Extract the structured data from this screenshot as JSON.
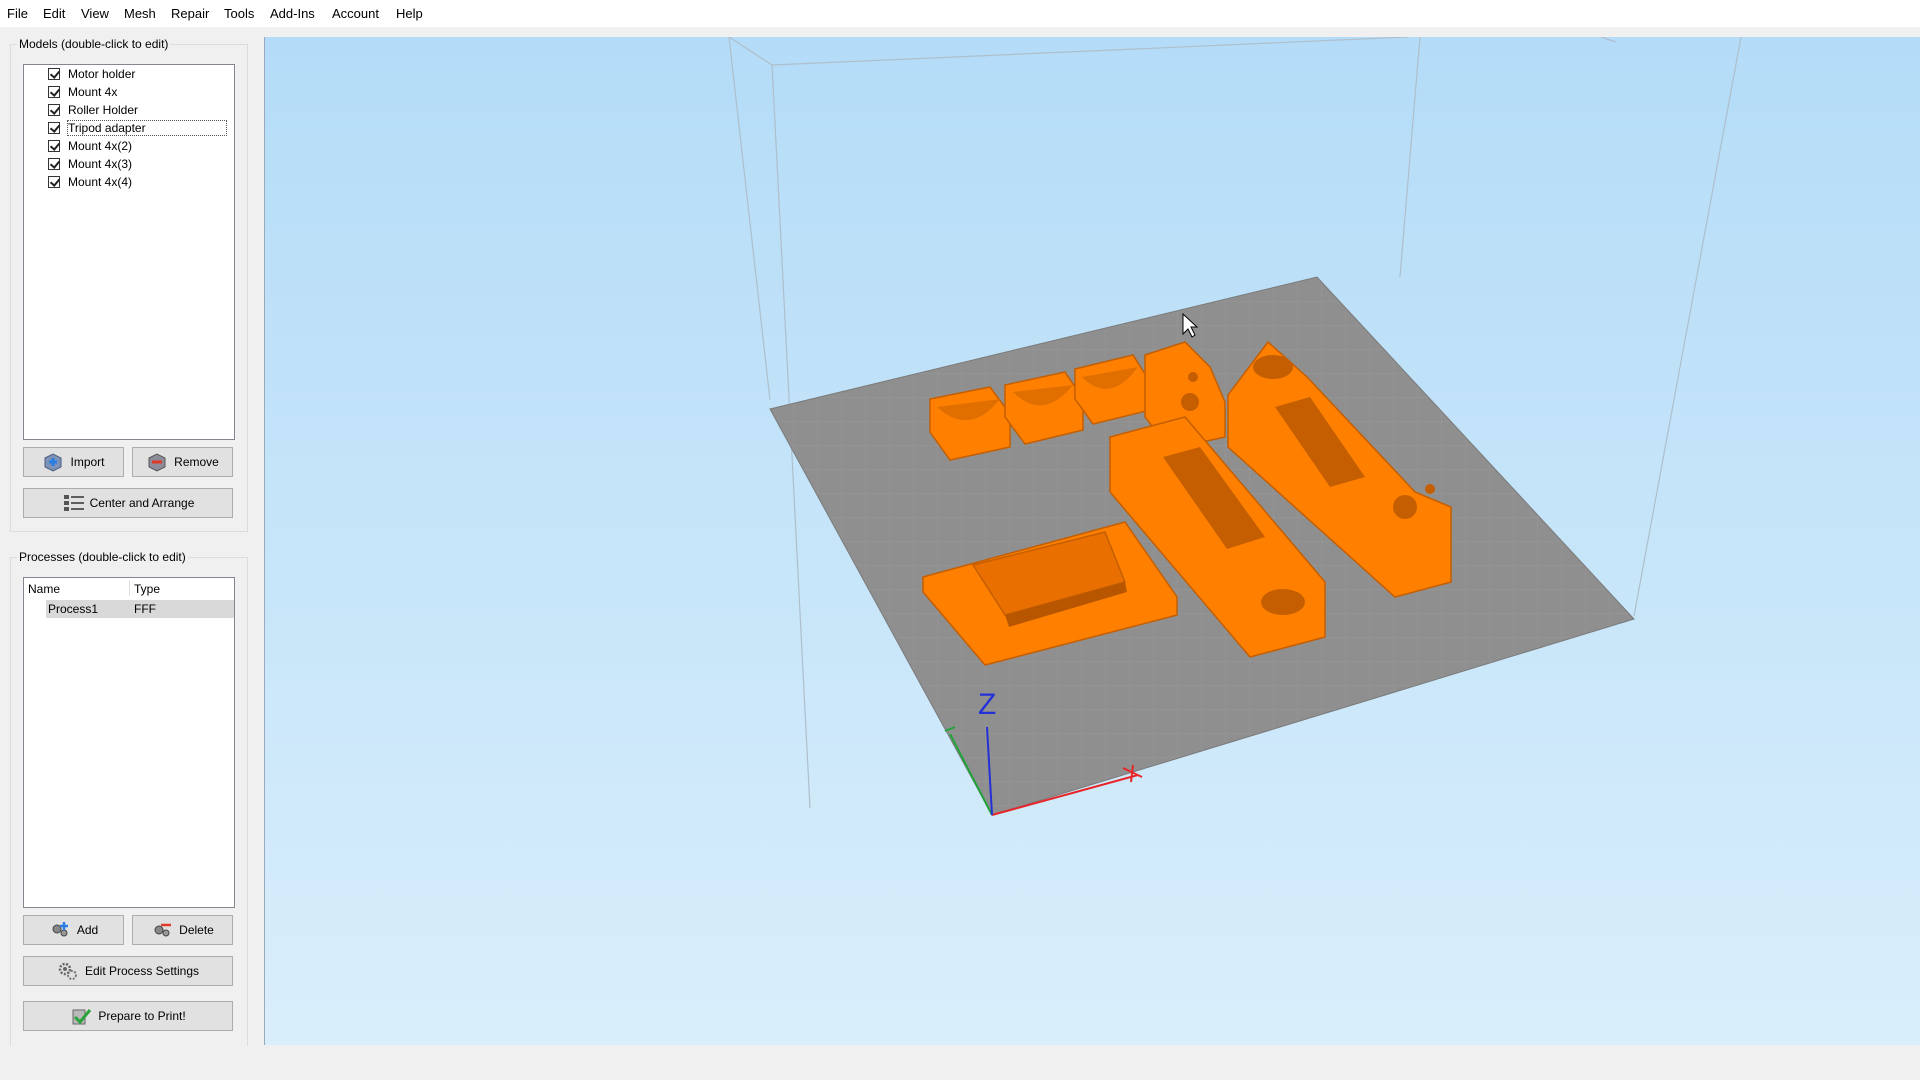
{
  "menu": [
    "File",
    "Edit",
    "View",
    "Mesh",
    "Repair",
    "Tools",
    "Add-Ins",
    "Account",
    "Help"
  ],
  "models_panel": {
    "title": "Models (double-click to edit)",
    "items": [
      "Motor holder",
      "Mount 4x",
      "Roller Holder",
      "Tripod adapter",
      "Mount 4x(2)",
      "Mount 4x(3)",
      "Mount 4x(4)"
    ],
    "focused_item": "Tripod adapter",
    "import_label": "Import",
    "remove_label": "Remove",
    "center_arrange_label": "Center and Arrange"
  },
  "processes_panel": {
    "title": "Processes (double-click to edit)",
    "columns": [
      "Name",
      "Type"
    ],
    "rows": [
      {
        "name": "Process1",
        "type": "FFF"
      }
    ],
    "add_label": "Add",
    "delete_label": "Delete",
    "edit_settings_label": "Edit Process Settings",
    "prepare_label": "Prepare to Print!"
  },
  "viewport": {
    "axis_z_label": "Z",
    "model_color": "#ff8000",
    "bed_color": "#8f8f8f",
    "axis_colors": {
      "x": "#e8262a",
      "y": "#22a33a",
      "z": "#2430d8"
    }
  },
  "icons": [
    "import-icon",
    "remove-icon",
    "center-arrange-icon",
    "add-icon",
    "delete-icon",
    "settings-gear-icon",
    "checkmark-icon",
    "mouse-cursor-icon"
  ]
}
